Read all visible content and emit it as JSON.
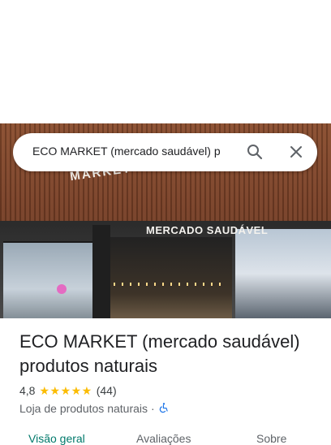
{
  "search": {
    "query": "ECO MARKET (mercado saudável) p",
    "search_icon": "search-icon",
    "close_icon": "close-icon"
  },
  "hero": {
    "sign_top": "MARKET",
    "sign_main": "MERCADO SAUDÁVEL"
  },
  "place": {
    "title": "ECO MARKET (mercado saudável) produtos naturais",
    "rating": "4,8",
    "stars": "★★★★★",
    "reviews": "(44)",
    "category": "Loja de produtos naturais",
    "separator": "·",
    "accessibility_icon": "wheelchair-icon"
  },
  "tabs": [
    {
      "label": "Visão geral",
      "active": true
    },
    {
      "label": "Avaliações",
      "active": false
    },
    {
      "label": "Sobre",
      "active": false
    }
  ],
  "colors": {
    "accent": "#00796b",
    "star": "#fbbc04",
    "link": "#1a73e8"
  }
}
